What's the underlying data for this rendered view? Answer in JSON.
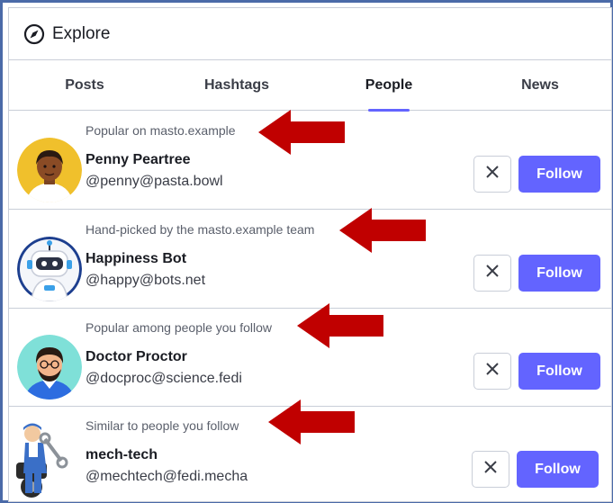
{
  "header": {
    "title": "Explore",
    "icon": "compass-icon"
  },
  "tabs": [
    {
      "label": "Posts",
      "active": false
    },
    {
      "label": "Hashtags",
      "active": false
    },
    {
      "label": "People",
      "active": true
    },
    {
      "label": "News",
      "active": false
    }
  ],
  "accent_color": "#6364ff",
  "annotation_arrow_color": "#c00000",
  "suggestions": [
    {
      "reason": "Popular on masto.example",
      "display_name": "Penny Peartree",
      "handle": "@penny@pasta.bowl",
      "follow_label": "Follow",
      "dismiss_icon": "close-icon"
    },
    {
      "reason": "Hand-picked by the masto.example team",
      "display_name": "Happiness Bot",
      "handle": "@happy@bots.net",
      "follow_label": "Follow",
      "dismiss_icon": "close-icon"
    },
    {
      "reason": "Popular among people you follow",
      "display_name": "Doctor Proctor",
      "handle": "@docproc@science.fedi",
      "follow_label": "Follow",
      "dismiss_icon": "close-icon"
    },
    {
      "reason": "Similar to people you follow",
      "display_name": "mech-tech",
      "handle": "@mechtech@fedi.mecha",
      "follow_label": "Follow",
      "dismiss_icon": "close-icon"
    }
  ]
}
